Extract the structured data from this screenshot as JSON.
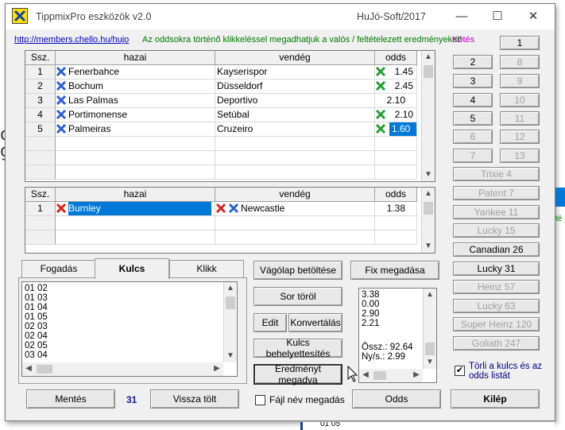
{
  "window": {
    "title": "TippmixPro eszközök  v2.0",
    "company": "HuJó-Soft/2017",
    "minimize_glyph": "—",
    "maximize_glyph": "☐",
    "close_glyph": "✕"
  },
  "header": {
    "url": "http://members.chello.hu/hujo",
    "hint": "Az oddsokra történő klikkeléssel megadhatjuk a valós /  feltételezett eredményeket!",
    "kotes": "Kötés"
  },
  "colors": {
    "accent": "#0078d7",
    "hint": "#007a00",
    "kotes": "#c000c0",
    "url": "#0000c0",
    "count": "#1a1aa0"
  },
  "table1": {
    "headers": [
      "Ssz.",
      "hazai",
      "vendég",
      "odds"
    ],
    "rows": [
      {
        "n": "1",
        "home": "Fenerbahce",
        "away": "Kayserispor",
        "odds": "1.45",
        "home_icon": "blue-x-icon",
        "odds_icon": "green-x-icon"
      },
      {
        "n": "2",
        "home": "Bochum",
        "away": "Düsseldorf",
        "odds": "2.45",
        "home_icon": "blue-x-icon",
        "odds_icon": "green-x-icon"
      },
      {
        "n": "3",
        "home": "Las Palmas",
        "away": "Deportivo",
        "odds": "2.10",
        "home_icon": "blue-x-icon",
        "odds_icon": ""
      },
      {
        "n": "4",
        "home": "Portimonense",
        "away": "Setúbal",
        "odds": "2.10",
        "home_icon": "blue-x-icon",
        "odds_icon": "green-x-icon"
      },
      {
        "n": "5",
        "home": "Palmeiras",
        "away": "Cruzeiro",
        "odds": "1.60",
        "home_icon": "blue-x-icon",
        "odds_icon": "green-x-icon",
        "selected_odds": true
      }
    ]
  },
  "table2": {
    "headers": [
      "Ssz.",
      "hazai",
      "vendég",
      "odds"
    ],
    "rows": [
      {
        "n": "1",
        "home": "Burnley",
        "away": "Newcastle",
        "odds": "1.38",
        "home_icon": "red-x-icon",
        "away_icons": [
          "red-x-icon",
          "blue-x-icon"
        ],
        "selected_home": true
      }
    ]
  },
  "tabs": [
    "Fogadás",
    "Kulcs",
    "Klikk"
  ],
  "active_tab": "Kulcs",
  "kulcs_list": [
    "01 02",
    "01 03",
    "01 04",
    "01 05",
    "02 03",
    "02 04",
    "02 05",
    "03 04"
  ],
  "buttons": {
    "vagolap": "Vágólap betöltése",
    "fix": "Fix megadása",
    "sor_torol": "Sor töröl",
    "edit": "Edit",
    "konvertalas": "Konvertálás",
    "kulcs_behely": "Kulcs behelyettesítés",
    "eredmeny": "Eredményt megadva",
    "mentes": "Mentés",
    "vissza": "Vissza tölt",
    "odds": "Odds",
    "kilep": "Kilép"
  },
  "count": "31",
  "filename_label": "Fájl név megadás",
  "result_list": [
    "3.38",
    "0.00",
    "2.90",
    "2.21"
  ],
  "summary": {
    "ossz": "Össz.: 92.64",
    "ny": "Ny/s.: 2.99"
  },
  "number_buttons": [
    {
      "label": "1",
      "enabled": true
    },
    {
      "label": "2",
      "enabled": true
    },
    {
      "label": "8",
      "enabled": false
    },
    {
      "label": "3",
      "enabled": true
    },
    {
      "label": "9",
      "enabled": false
    },
    {
      "label": "4",
      "enabled": true
    },
    {
      "label": "10",
      "enabled": false
    },
    {
      "label": "5",
      "enabled": true
    },
    {
      "label": "11",
      "enabled": false
    },
    {
      "label": "6",
      "enabled": false
    },
    {
      "label": "12",
      "enabled": false
    },
    {
      "label": "7",
      "enabled": false
    },
    {
      "label": "13",
      "enabled": false
    }
  ],
  "system_buttons": [
    {
      "label": "Trixie 4",
      "enabled": false
    },
    {
      "label": "Patent 7",
      "enabled": false
    },
    {
      "label": "Yankee 11",
      "enabled": false
    },
    {
      "label": "Lucky 15",
      "enabled": false
    },
    {
      "label": "Canadian 26",
      "enabled": true
    },
    {
      "label": "Lucky 31",
      "enabled": true
    },
    {
      "label": "Heinz 57",
      "enabled": false
    },
    {
      "label": "Lucky 63",
      "enabled": false
    },
    {
      "label": "Super Heinz 120",
      "enabled": false
    },
    {
      "label": "Goliath 247",
      "enabled": false
    }
  ],
  "torli_label": "Törli a kulcs és az odds listát",
  "background": {
    "left_fragments": [
      "ol",
      "g"
    ],
    "bottom_text": "01 05",
    "right_fragment": "té"
  }
}
